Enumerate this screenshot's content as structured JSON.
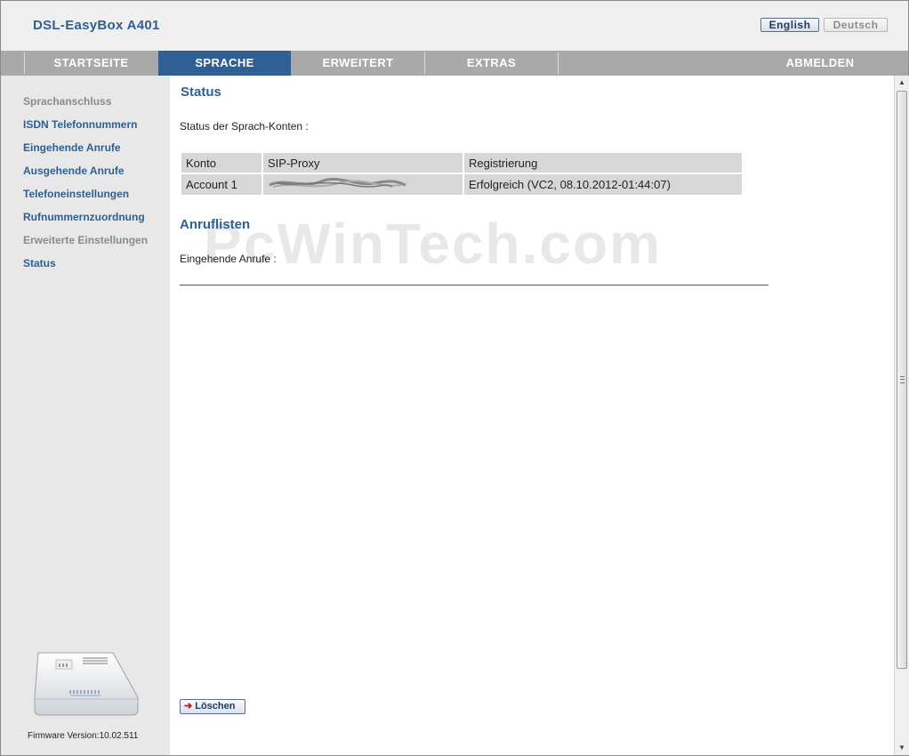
{
  "header": {
    "brand": "DSL-EasyBox A401",
    "lang_english": "English",
    "lang_deutsch": "Deutsch"
  },
  "nav": {
    "items": [
      "STARTSEITE",
      "SPRACHE",
      "ERWEITERT",
      "EXTRAS"
    ],
    "logout": "ABMELDEN",
    "active": "SPRACHE"
  },
  "sidebar": {
    "items": [
      "Sprachanschluss",
      "ISDN Telefonnummern",
      "Eingehende Anrufe",
      "Ausgehende Anrufe",
      "Telefoneinstellungen",
      "Rufnummernzuordnung",
      "Erweiterte Einstellungen",
      "Status"
    ],
    "firmware": "Firmware Version:10.02.511"
  },
  "main": {
    "status_title": "Status",
    "status_subtitle": "Status der Sprach-Konten :",
    "table": {
      "headers": [
        "Konto",
        "SIP-Proxy",
        "Registrierung"
      ],
      "rows": [
        [
          "Account 1",
          "",
          "Erfolgreich (VC2, 08.10.2012-01:44:07)"
        ]
      ]
    },
    "calllists_title": "Anruflisten",
    "incoming_label": "Eingehende Anrufe :",
    "delete_button": "Löschen",
    "watermark": "PcWinTech.com"
  },
  "colors": {
    "accent": "#2f5f93",
    "nav_bg": "#a9a9a9",
    "sidebar_bg": "#e8e8e8"
  }
}
